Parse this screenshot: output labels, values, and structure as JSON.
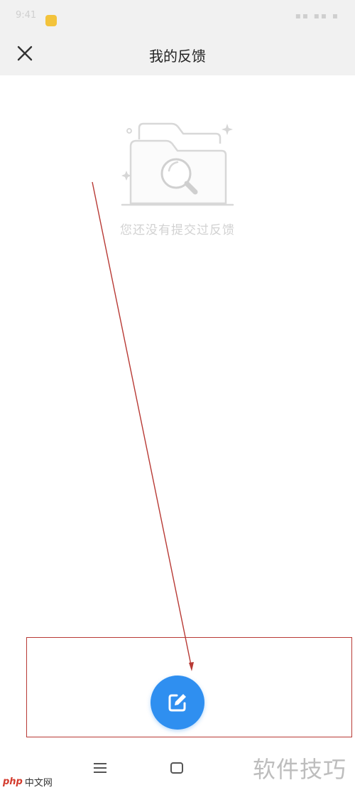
{
  "status_bar": {
    "time": "9:41",
    "icons": "▪▪ ▪▪ ▪"
  },
  "header": {
    "title": "我的反馈",
    "close_icon": "close-icon"
  },
  "empty_state": {
    "icon": "folder-search-icon",
    "message": "您还没有提交过反馈"
  },
  "fab": {
    "icon": "edit-icon",
    "color": "#2f8ff0"
  },
  "nav_bar": {
    "menu_icon": "menu-icon",
    "home_icon": "home-icon"
  },
  "watermarks": {
    "left_logo": "php",
    "left_text": "中文网",
    "right_text": "软件技巧"
  },
  "annotation": {
    "color": "#b83a35"
  }
}
